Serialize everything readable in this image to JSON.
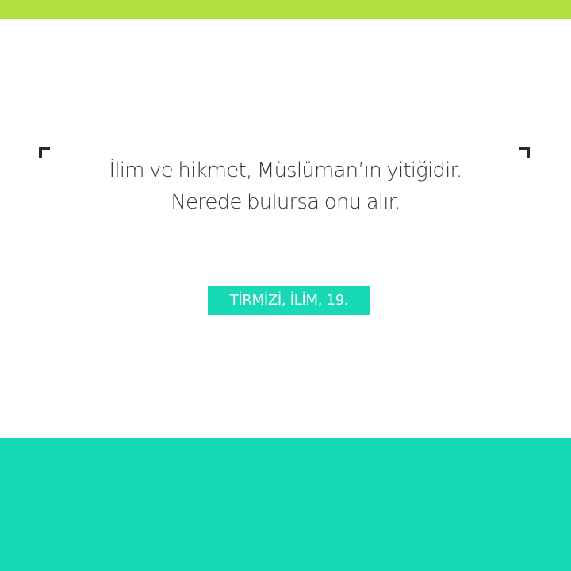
{
  "quote": {
    "line1": "İlim ve hikmet, Müslüman’ın yitiğidir.",
    "line2": "Nerede bulursa onu alır."
  },
  "source": {
    "label": "TİRMİZİ, İLİM, 19."
  },
  "colors": {
    "top_band": "#b3de3f",
    "accent_teal": "#17d9b4",
    "corner_marks": "#2a2a2a",
    "text": "#333333"
  },
  "icons": {
    "left_corner": "corner-bracket-top-left-icon",
    "right_corner": "corner-bracket-top-right-icon"
  }
}
